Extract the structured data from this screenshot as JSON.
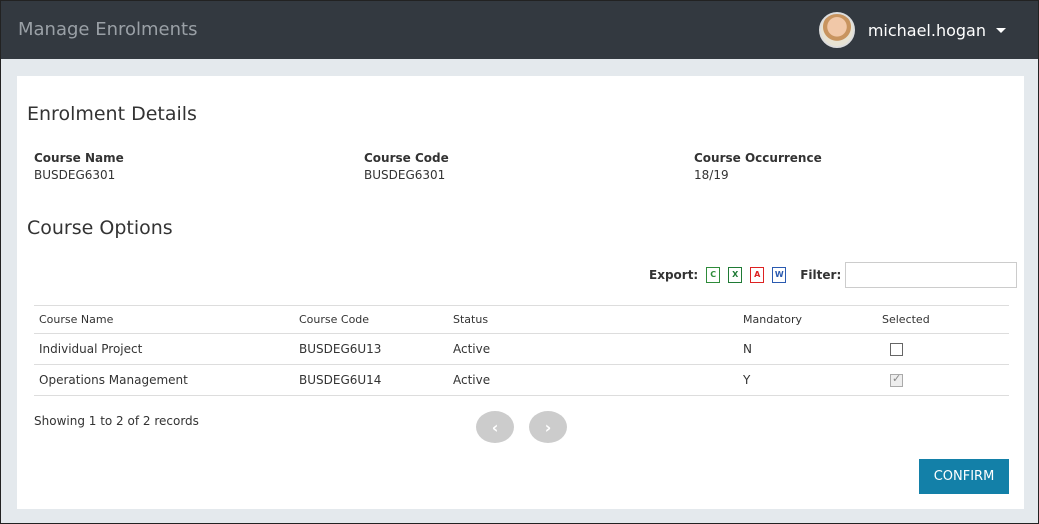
{
  "header": {
    "title": "Manage Enrolments",
    "username": "michael.hogan",
    "avatar_icon": "user-avatar",
    "dropdown_icon": "caret-down-icon"
  },
  "enrolment": {
    "heading": "Enrolment Details",
    "fields": [
      {
        "label": "Course Name",
        "value": "BUSDEG6301"
      },
      {
        "label": "Course Code",
        "value": "BUSDEG6301"
      },
      {
        "label": "Course Occurrence",
        "value": "18/19"
      }
    ]
  },
  "options": {
    "heading": "Course Options",
    "export_label": "Export:",
    "export_icons": [
      {
        "name": "csv-icon",
        "glyph": "C",
        "color": "#2e8b3a"
      },
      {
        "name": "excel-icon",
        "glyph": "X",
        "color": "#1f7a35"
      },
      {
        "name": "pdf-icon",
        "glyph": "A",
        "color": "#d22"
      },
      {
        "name": "word-icon",
        "glyph": "W",
        "color": "#2a5ab0"
      }
    ],
    "filter_label": "Filter:",
    "filter_value": "",
    "columns": [
      "Course Name",
      "Course Code",
      "Status",
      "Mandatory",
      "Selected"
    ],
    "rows": [
      {
        "name": "Individual Project",
        "code": "BUSDEG6U13",
        "status": "Active",
        "mandatory": "N",
        "selected": false
      },
      {
        "name": "Operations Management",
        "code": "BUSDEG6U14",
        "status": "Active",
        "mandatory": "Y",
        "selected": true
      }
    ],
    "records_text": "Showing 1 to 2 of 2 records",
    "prev_glyph": "‹",
    "next_glyph": "›",
    "confirm_label": "CONFIRM"
  }
}
